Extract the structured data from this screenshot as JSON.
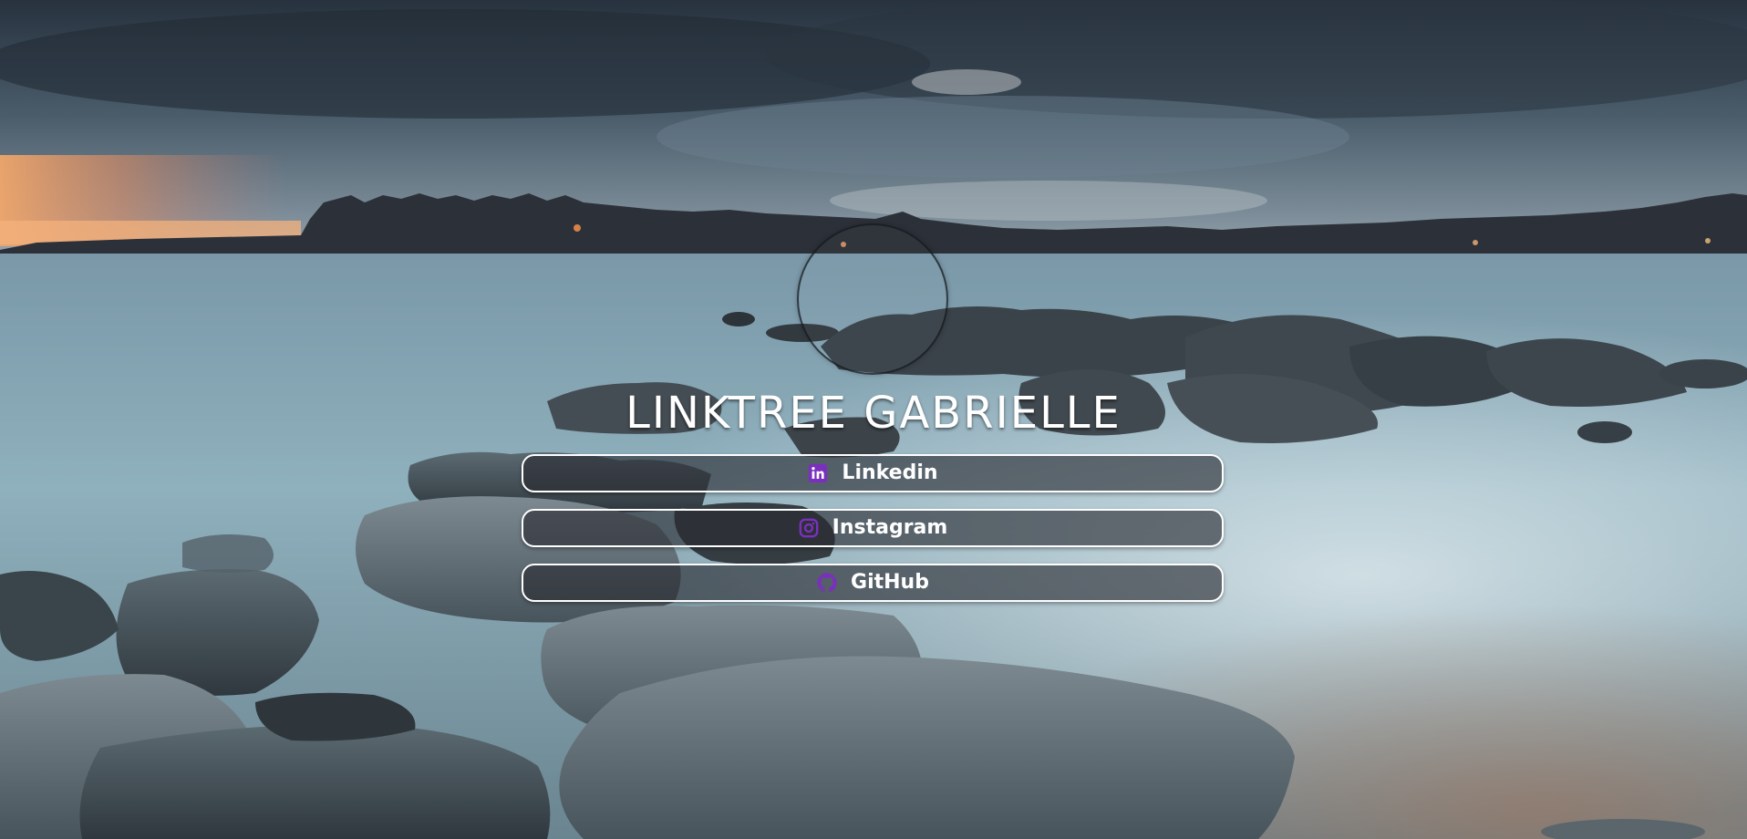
{
  "profile": {
    "title": "LINKTREE GABRIELLE"
  },
  "links": [
    {
      "label": "Linkedin",
      "icon": "linkedin-icon"
    },
    {
      "label": "Instagram",
      "icon": "instagram-icon"
    },
    {
      "label": "GitHub",
      "icon": "github-icon"
    }
  ],
  "colors": {
    "icon_accent": "#7b2fbe",
    "button_border": "#ffffff",
    "text": "#ffffff"
  }
}
